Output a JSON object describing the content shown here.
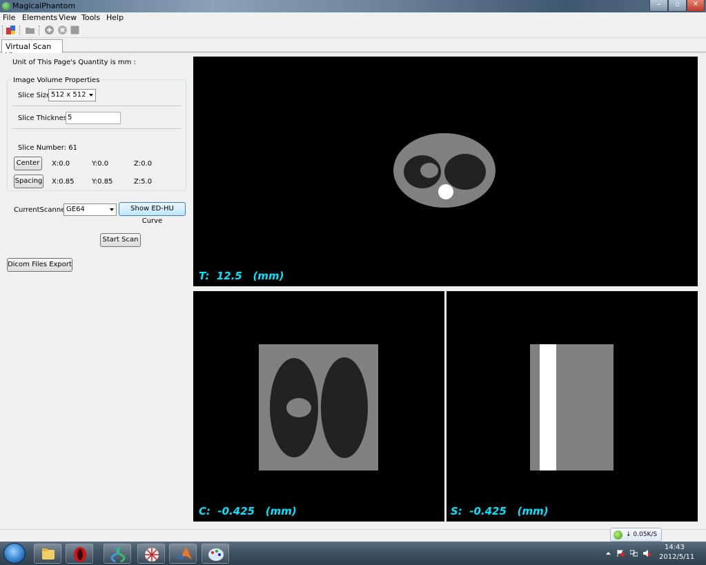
{
  "window": {
    "title": "MagicalPhantom"
  },
  "menu": [
    "File",
    "Elements",
    "View",
    "Tools",
    "Help"
  ],
  "tabs": [
    {
      "label": "Virtual Scan View",
      "active": true
    }
  ],
  "panel": {
    "unit_text": "Unit of This Page's Quantity is mm :",
    "group_title": "Image Volume Properties",
    "slice_size_label": "Slice Size:",
    "slice_size_value": "512 x 512",
    "slice_thickness_label": "Slice Thickness:",
    "slice_thickness_value": "5",
    "slice_number_text": "Slice Number: 61",
    "center_button": "Center",
    "center": {
      "x": "X:0.0",
      "y": "Y:0.0",
      "z": "Z:0.0"
    },
    "spacing_button": "Spacing",
    "spacing": {
      "x": "X:0.85",
      "y": "Y:0.85",
      "z": "Z:5.0"
    },
    "scanner_label": "CurrentScanner:",
    "scanner_value": "GE64",
    "ed_hu_button": "Show ED-HU Curve",
    "start_scan_button": "Start Scan",
    "dicom_export_button": "Dicom Files Export"
  },
  "views": {
    "transverse": "T:  12.5   (mm)",
    "coronal": "C:  -0.425   (mm)",
    "sagittal": "S:  -0.425   (mm)"
  },
  "netspeed": "↓ 0.05K/S",
  "taskbar": {
    "time": "14:43",
    "date": "2012/5/11"
  }
}
